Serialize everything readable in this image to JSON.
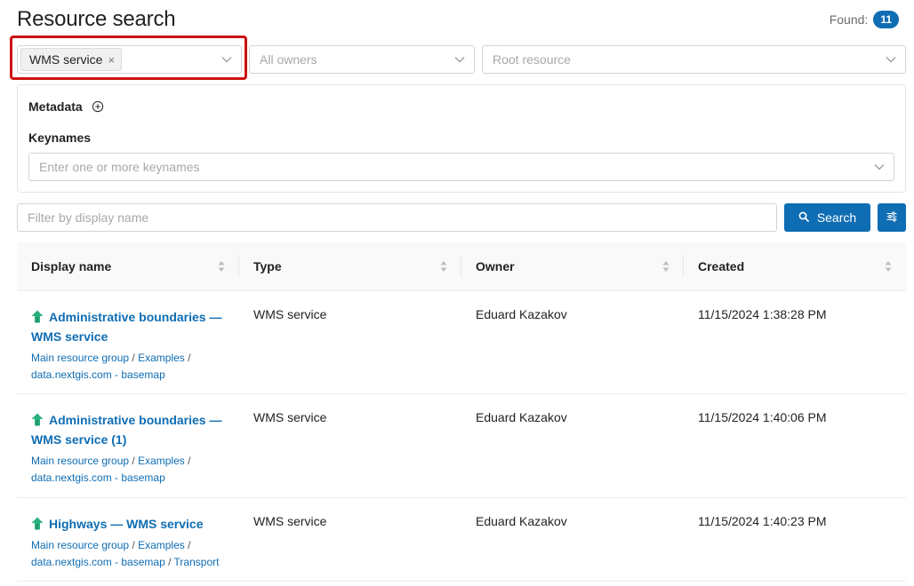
{
  "header": {
    "title": "Resource search",
    "found_label": "Found:",
    "found_count": "11"
  },
  "filters": {
    "type_tag": "WMS service",
    "type_tag_remove": "×",
    "owners_placeholder": "All owners",
    "root_placeholder": "Root resource"
  },
  "metadata": {
    "title": "Metadata",
    "keynames_label": "Keynames",
    "keynames_placeholder": "Enter one or more keynames"
  },
  "search": {
    "filter_placeholder": "Filter by display name",
    "button_label": "Search"
  },
  "table": {
    "columns": [
      "Display name",
      "Type",
      "Owner",
      "Created"
    ],
    "rows": [
      {
        "name_line1": "Administrative boundaries —",
        "name_line2": "WMS service",
        "path": [
          "Main resource group",
          "Examples",
          "data.nextgis.com - basemap"
        ],
        "type": "WMS service",
        "owner": "Eduard Kazakov",
        "created": "11/15/2024 1:38:28 PM"
      },
      {
        "name_line1": "Administrative boundaries —",
        "name_line2": "WMS service (1)",
        "path": [
          "Main resource group",
          "Examples",
          "data.nextgis.com - basemap"
        ],
        "type": "WMS service",
        "owner": "Eduard Kazakov",
        "created": "11/15/2024 1:40:06 PM"
      },
      {
        "name_line1": "Highways — WMS service",
        "name_line2": "",
        "path": [
          "Main resource group",
          "Examples",
          "data.nextgis.com - basemap",
          "Transport"
        ],
        "type": "WMS service",
        "owner": "Eduard Kazakov",
        "created": "11/15/2024 1:40:23 PM"
      }
    ]
  },
  "colors": {
    "accent": "#0f6db3",
    "highlight": "#cc1111",
    "resource_icon": "#2bb07f"
  },
  "icons": {
    "resource": "wms-service-icon",
    "search": "search-icon",
    "settings": "sliders-icon",
    "sort": "sort-icon",
    "add": "plus-circle-icon",
    "chevron": "chevron-down-icon"
  }
}
